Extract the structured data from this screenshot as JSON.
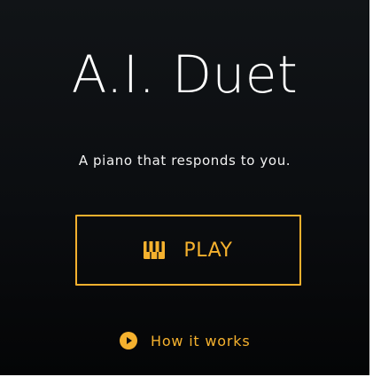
{
  "app": {
    "title": "A.I. Duet",
    "subtitle": "A piano that responds to you."
  },
  "play_button": {
    "label": "PLAY",
    "icon": "piano-keys-icon"
  },
  "how_it_works": {
    "label": "How it works",
    "icon": "play-circle-icon"
  },
  "colors": {
    "accent": "#f5b12e",
    "background": "#0b0d10",
    "text": "#ffffff"
  }
}
